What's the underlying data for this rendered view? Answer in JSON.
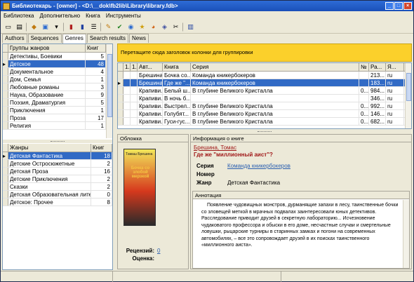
{
  "window": {
    "title": "Библиотекарь - [owner] - <D:\\__dok\\fb2lib\\Library\\library.fdb>"
  },
  "menu": [
    "Библиотека",
    "Дополнительно",
    "Книга",
    "Инструменты"
  ],
  "toolbar_icons": [
    "new-icon",
    "open-icon",
    "import-icon",
    "export-icon",
    "settings-icon",
    "book-icon",
    "book2-icon",
    "list-icon",
    "edit-icon",
    "check-icon",
    "sync-icon",
    "star-icon",
    "rss-icon",
    "tag-icon",
    "tools-icon",
    "exit-icon"
  ],
  "tabs": [
    "Authors",
    "Sequences",
    "Genres",
    "Search results",
    "News"
  ],
  "active_tab": 2,
  "genre_groups": {
    "headers": [
      "Группы жанров",
      "Книг"
    ],
    "rows": [
      [
        "Детективы, Боевики",
        "5"
      ],
      [
        "Детское",
        "48"
      ],
      [
        "Документальное",
        "4"
      ],
      [
        "Дом, Семья",
        "1"
      ],
      [
        "Любовные романы",
        "3"
      ],
      [
        "Наука, Образование",
        "9"
      ],
      [
        "Поэзия, Драматургия",
        "5"
      ],
      [
        "Приключения",
        "1"
      ],
      [
        "Проза",
        "17"
      ],
      [
        "Религия",
        "1"
      ]
    ],
    "selected": 1
  },
  "genres": {
    "headers": [
      "Жанры",
      "Книг"
    ],
    "rows": [
      [
        "Детская Фантастика",
        "18"
      ],
      [
        "Детские Остросюжетные",
        "2"
      ],
      [
        "Детская Проза",
        "16"
      ],
      [
        "Детские Приключения",
        "2"
      ],
      [
        "Сказки",
        "2"
      ],
      [
        "Детская Образовательная лите...",
        "0"
      ],
      [
        "Детское: Прочее",
        "8"
      ]
    ],
    "selected": 0
  },
  "group_area": {
    "text": "Перетащите сюда заголовок колонки для группировки"
  },
  "books": {
    "headers": [
      "1..",
      "1..",
      "Авт...",
      "Книга",
      "Серия",
      "№",
      "Ра...",
      "Я..."
    ],
    "rows": [
      [
        "",
        "",
        "Брешина,...",
        "Бочка со...",
        "Команда кникербокеров",
        "",
        "213...",
        "ru"
      ],
      [
        "",
        "",
        "Брешина,...",
        "Где же \"...",
        "Команда кникербокеров",
        "",
        "183...",
        "ru"
      ],
      [
        "",
        "",
        "Крапиви...",
        "Белый ш...",
        "В глубине Великого Кристалла",
        "0...",
        "984...",
        "ru"
      ],
      [
        "",
        "",
        "Крапиви...",
        "В ночь б...",
        "",
        "",
        "346...",
        "ru"
      ],
      [
        "",
        "",
        "Крапиви...",
        "Выстрел...",
        "В глубине Великого Кристалла",
        "0...",
        "992...",
        "ru"
      ],
      [
        "",
        "",
        "Крапиви...",
        "Голубят...",
        "В глубине Великого Кристалла",
        "0...",
        "146...",
        "ru"
      ],
      [
        "",
        "",
        "Крапиви...",
        "Гуси-гус...",
        "В глубине Великого Кристалла",
        "0...",
        "682...",
        "ru"
      ]
    ],
    "selected": 1
  },
  "cover": {
    "caption": "Обложка",
    "author": "Тамаш Брешина",
    "title": "Бочка со злобой мерзкой",
    "reviews_label": "Рецензий:",
    "reviews_value": "0",
    "rating_label": "Оценка:"
  },
  "info": {
    "caption": "Информация о книге",
    "author": "Брешина, Томас",
    "title": "Где же \"миллионный аист\"?",
    "fields": [
      {
        "label": "Серия",
        "value": "Команда кникербокеров"
      },
      {
        "label": "Номер",
        "value": ""
      },
      {
        "label": "Жанр",
        "value": "Детская Фантастика"
      }
    ]
  },
  "annotation": {
    "caption": "Аннотация",
    "text": "Появление чудовищных монстров, дурманящие запахи в лесу, таинственные бочки со зловещей меткой в мрачных подвалах заинтересовали юных детективов. Расследование приводит друзей в секретную лабораторию... Исчезновение чудаковатого профессора и обыски в его доме, несчастные случаи и смертельные ловушки, рыцарские турниры в старинных замках и погони на современных автомобилях, – все это сопровождает друзей в их поисках таинственного «миллионного аиста»."
  },
  "colors": {
    "selection": "#316ac5",
    "group_area": "#fbd02b",
    "title_bar": "#2e6cd6",
    "link": "#2a5fb0",
    "author_red": "#a01818"
  }
}
